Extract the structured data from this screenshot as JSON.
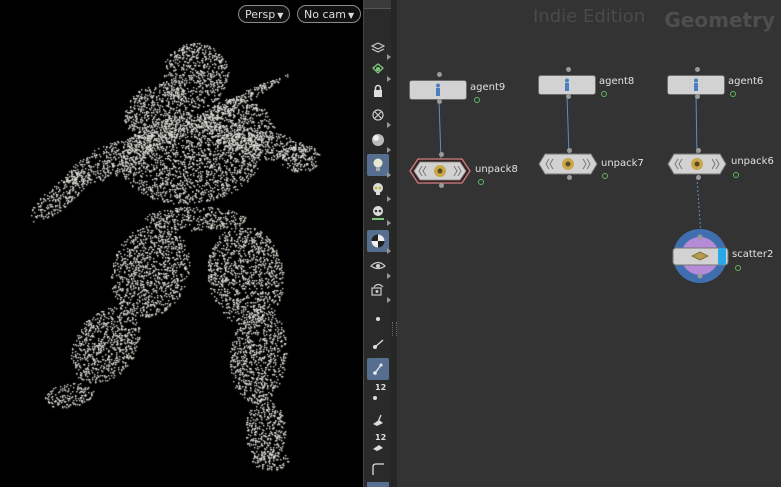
{
  "viewport": {
    "camera_menu": "Persp",
    "view_menu": "No cam"
  },
  "network": {
    "watermark": "Indie Edition",
    "context": "Geometry",
    "nodes": [
      {
        "name": "agent9",
        "type": "agent"
      },
      {
        "name": "agent8",
        "type": "agent"
      },
      {
        "name": "agent6",
        "type": "agent"
      },
      {
        "name": "unpack8",
        "type": "agentunpack"
      },
      {
        "name": "unpack7",
        "type": "agentunpack"
      },
      {
        "name": "unpack6",
        "type": "agentunpack"
      },
      {
        "name": "scatter2",
        "type": "scatter"
      }
    ]
  },
  "toolbar": {
    "number_badge_1": "12",
    "number_badge_2": "12"
  },
  "colors": {
    "viewport_bg": "#000000",
    "point_cloud": "#d8d8d0",
    "network_bg": "#333333",
    "node_body": "#d2d2d2",
    "wire": "#5a8ec8",
    "display_flag": "#5fb85f",
    "scatter_ring": "#3f6fae",
    "scatter_inner": "#b58ad6",
    "active_tool": "#566e8f"
  }
}
